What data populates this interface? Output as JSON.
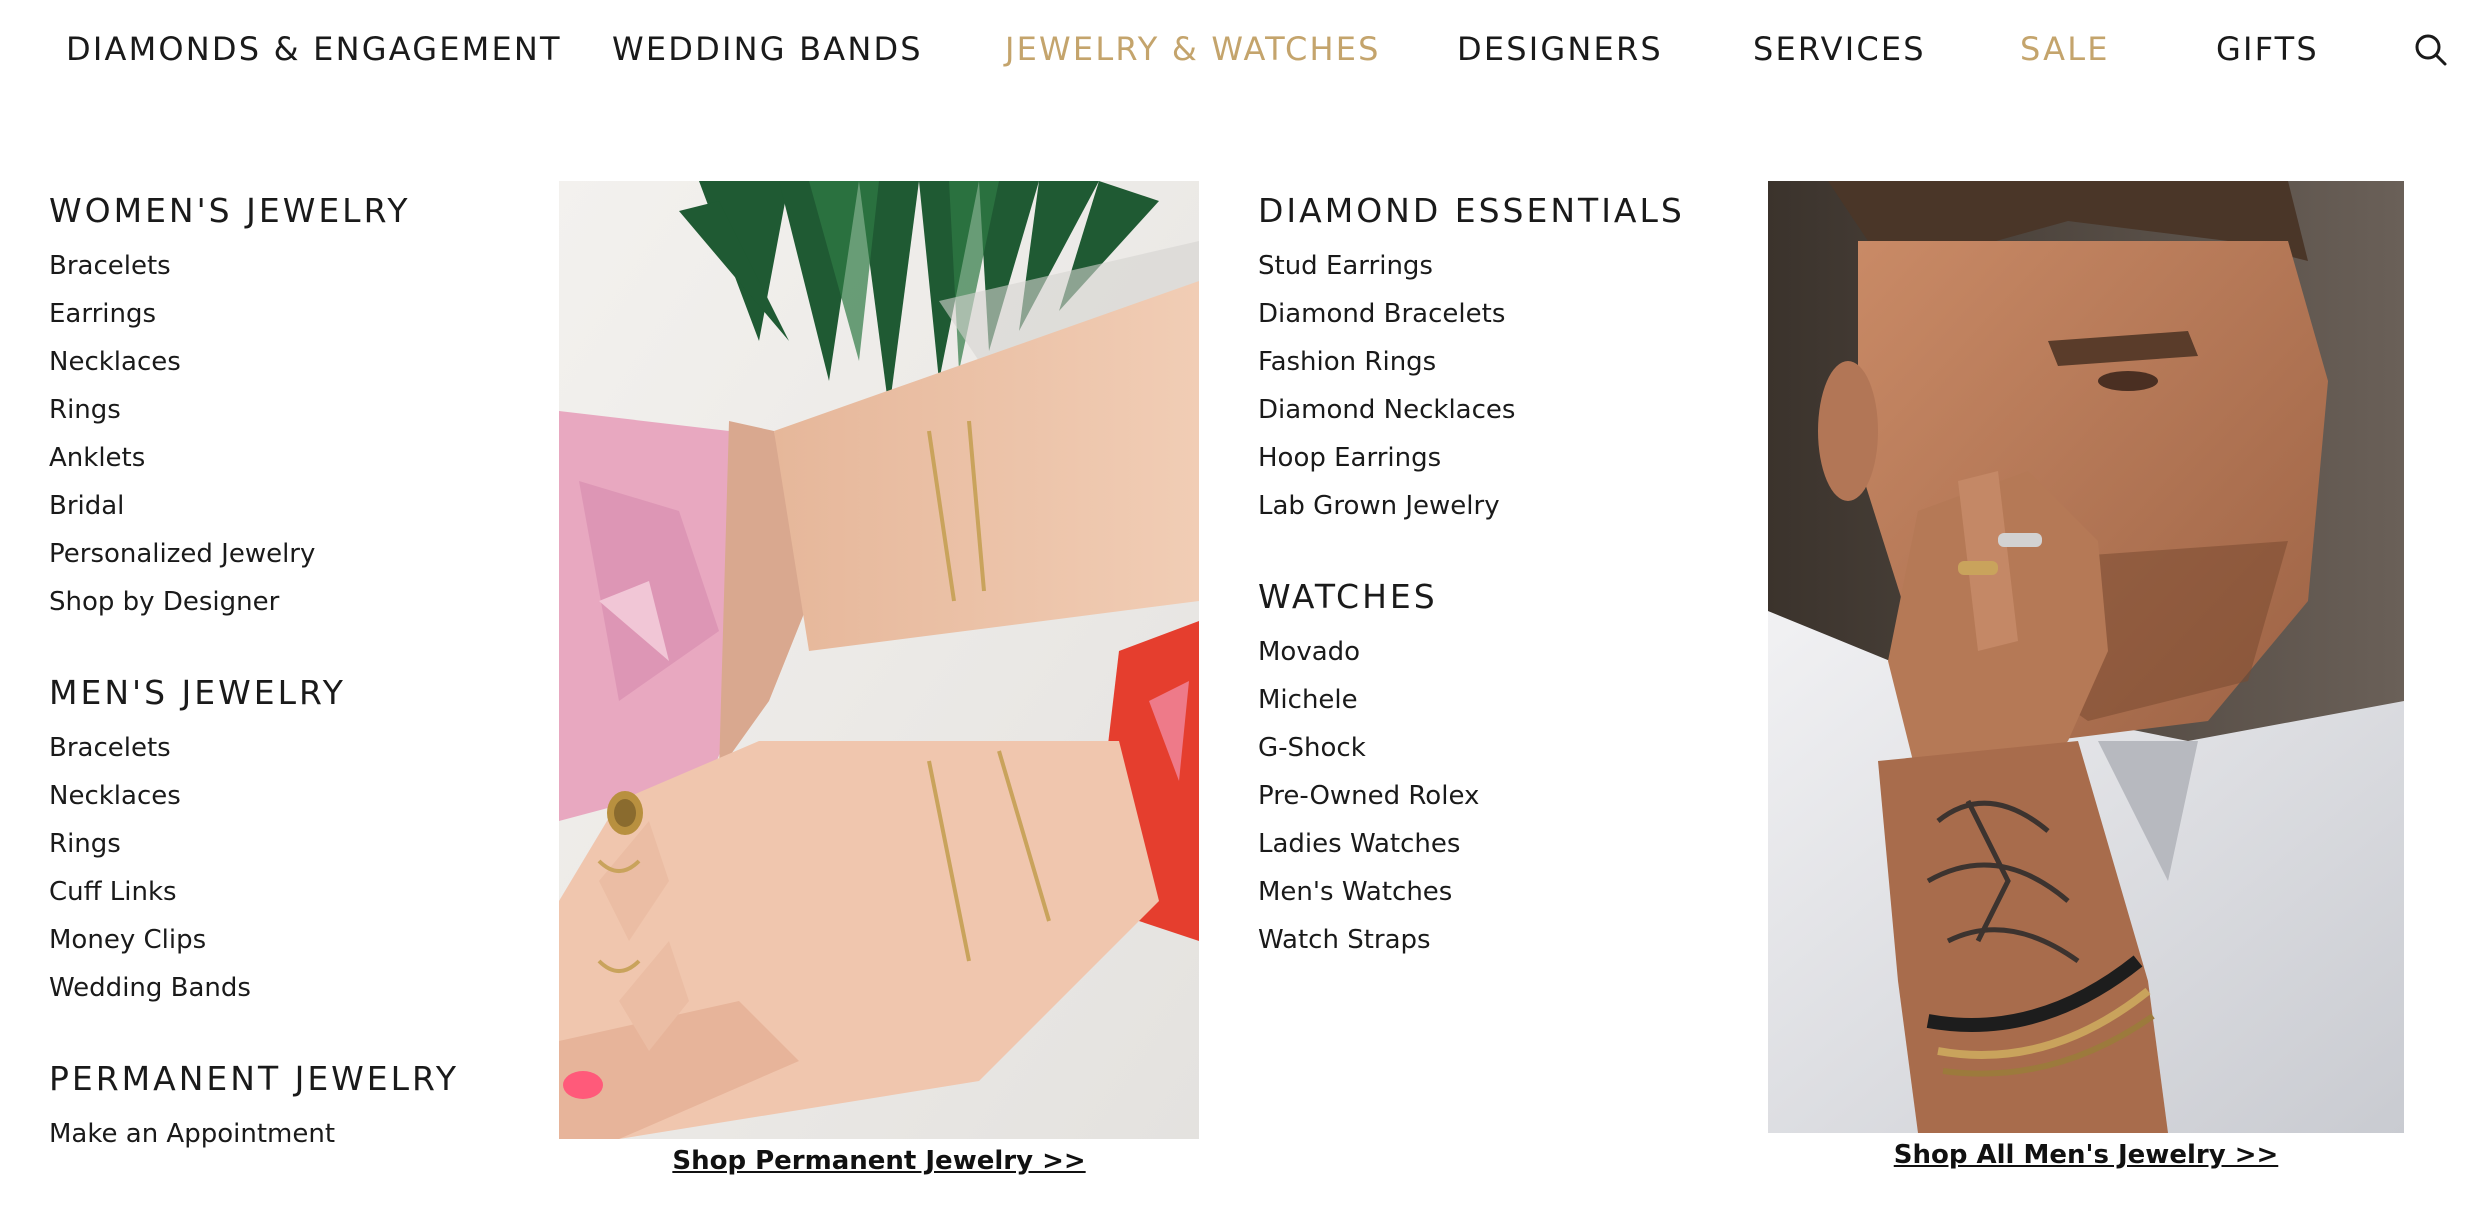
{
  "nav": {
    "items": [
      {
        "label": "DIAMONDS & ENGAGEMENT"
      },
      {
        "label": "WEDDING BANDS"
      },
      {
        "label": "JEWELRY & WATCHES"
      },
      {
        "label": "DESIGNERS"
      },
      {
        "label": "SERVICES"
      },
      {
        "label": "SALE"
      },
      {
        "label": "GIFTS"
      }
    ],
    "search_icon": "search-icon"
  },
  "colors": {
    "accent": "#C4A46C",
    "text": "#1A1A1A"
  },
  "menu": {
    "womens": {
      "title": "WOMEN'S JEWELRY",
      "links": [
        "Bracelets",
        "Earrings",
        "Necklaces",
        "Rings",
        "Anklets",
        "Bridal",
        "Personalized Jewelry",
        "Shop by Designer"
      ]
    },
    "mens": {
      "title": "MEN'S JEWELRY",
      "links": [
        "Bracelets",
        "Necklaces",
        "Rings",
        "Cuff Links",
        "Money Clips",
        "Wedding Bands"
      ]
    },
    "permanent": {
      "title": "PERMANENT JEWELRY",
      "links": [
        "Make an Appointment"
      ]
    },
    "diamond": {
      "title": "DIAMOND ESSENTIALS",
      "links": [
        "Stud Earrings",
        "Diamond Bracelets",
        "Fashion Rings",
        "Diamond Necklaces",
        "Hoop Earrings",
        "Lab Grown Jewelry"
      ]
    },
    "watches": {
      "title": "WATCHES",
      "links": [
        "Movado",
        "Michele",
        "G-Shock",
        "Pre-Owned Rolex",
        "Ladies Watches",
        "Men's Watches",
        "Watch Straps"
      ]
    }
  },
  "promos": {
    "permanent": {
      "caption": "Shop Permanent Jewelry >>"
    },
    "mens": {
      "caption": "Shop All Men's Jewelry >>"
    }
  }
}
